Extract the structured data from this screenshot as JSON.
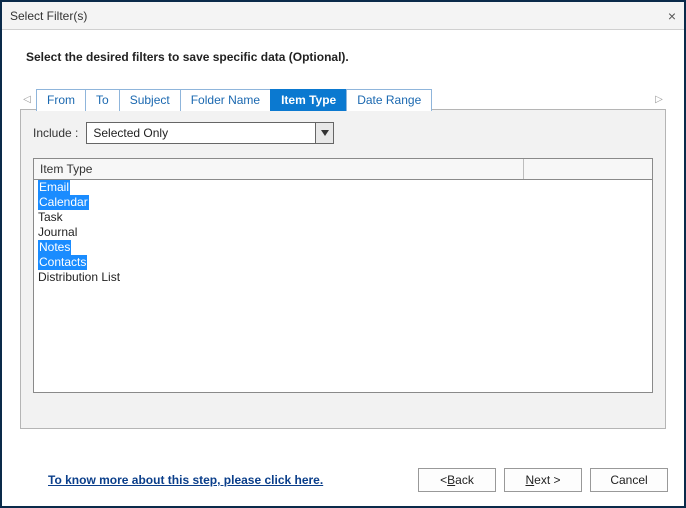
{
  "window": {
    "title": "Select Filter(s)",
    "close_label": "×"
  },
  "instruction": "Select the desired filters to save specific data (Optional).",
  "tabs": {
    "arrow_left": "◁",
    "arrow_right": "▷",
    "items": [
      {
        "label": "From",
        "active": false
      },
      {
        "label": "To",
        "active": false
      },
      {
        "label": "Subject",
        "active": false
      },
      {
        "label": "Folder Name",
        "active": false
      },
      {
        "label": "Item Type",
        "active": true
      },
      {
        "label": "Date Range",
        "active": false
      }
    ]
  },
  "include": {
    "label": "Include :",
    "value": "Selected Only"
  },
  "list": {
    "header": "Item Type",
    "items": [
      {
        "label": "Email",
        "selected": true
      },
      {
        "label": "Calendar",
        "selected": true
      },
      {
        "label": "Task",
        "selected": false
      },
      {
        "label": "Journal",
        "selected": false
      },
      {
        "label": "Notes",
        "selected": true
      },
      {
        "label": "Contacts",
        "selected": true
      },
      {
        "label": "Distribution List",
        "selected": false
      }
    ]
  },
  "footer": {
    "help_link": "To know more about this step, please click here.",
    "back_prefix": "< ",
    "back_ul": "B",
    "back_suffix": "ack",
    "next_ul": "N",
    "next_suffix": "ext >",
    "cancel": "Cancel"
  }
}
